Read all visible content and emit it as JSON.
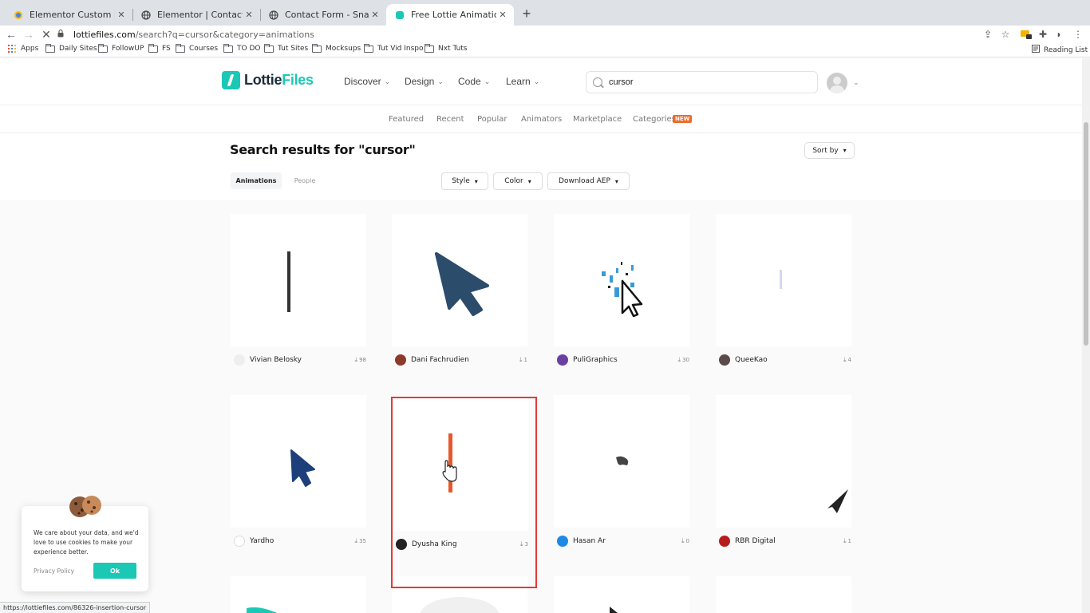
{
  "browser": {
    "tabs": [
      {
        "title": "Elementor Custom Mouse Curs",
        "icon": "google-drive-icon"
      },
      {
        "title": "Elementor | Contact Form",
        "icon": "globe-icon"
      },
      {
        "title": "Contact Form - Snappy Sports",
        "icon": "globe-icon"
      },
      {
        "title": "Free Lottie Animation Files, To",
        "icon": "lottiefiles-icon",
        "active": true
      }
    ],
    "url_host": "lottiefiles.com",
    "url_path": "/search?q=cursor&category=animations",
    "bookmarks": [
      "Apps",
      "Daily Sites",
      "FollowUP",
      "FS",
      "Courses",
      "TO DO",
      "Tut Sites",
      "Mocksups",
      "Tut Vid Inspo",
      "Nxt Tuts"
    ],
    "reading_list": "Reading List",
    "status_url": "https://lottiefiles.com/86326-insertion-cursor"
  },
  "header": {
    "logo_part1": "Lottie",
    "logo_part2": "Files",
    "nav": [
      "Discover",
      "Design",
      "Code",
      "Learn"
    ],
    "search_value": "cursor"
  },
  "subnav": {
    "items": [
      "Featured",
      "Recent",
      "Popular",
      "Animators",
      "Marketplace",
      "Categories"
    ],
    "badge": "NEW"
  },
  "results": {
    "title": "Search results for \"cursor\"",
    "sort_label": "Sort by",
    "segments": [
      "Animations",
      "People"
    ],
    "filters": [
      "Style",
      "Color",
      "Download AEP"
    ]
  },
  "cards": [
    {
      "author": "Vivian Belosky",
      "downloads": "98",
      "avatar_color": "#777777"
    },
    {
      "author": "Dani Fachrudien",
      "downloads": "1",
      "avatar_color": "#8b3a2b"
    },
    {
      "author": "PuliGraphics",
      "downloads": "30",
      "avatar_color": "#6b3fa0"
    },
    {
      "author": "QueeKao",
      "downloads": "4",
      "avatar_color": "#5a4a4a"
    },
    {
      "author": "Yardho",
      "downloads": "35",
      "avatar_color": "#dddddd"
    },
    {
      "author": "Dyusha King",
      "downloads": "3",
      "avatar_color": "#222222"
    },
    {
      "author": "Hasan Ar",
      "downloads": "0",
      "avatar_color": "#1e88e5"
    },
    {
      "author": "RBR Digital",
      "downloads": "1",
      "avatar_color": "#b71c1c"
    }
  ],
  "cookie": {
    "text": "We care about your data, and we'd love to use cookies to make your experience better.",
    "policy": "Privacy Policy",
    "ok": "Ok"
  },
  "colors": {
    "brand": "#1ac8b5",
    "badge": "#f06a2b",
    "highlight": "#e53935"
  }
}
